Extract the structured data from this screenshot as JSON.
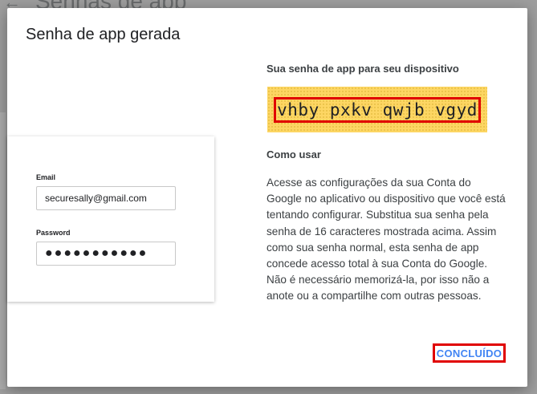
{
  "background": {
    "page_title": "Senhas de app",
    "back_icon": "arrow-left-icon"
  },
  "dialog": {
    "title": "Senha de app gerada",
    "illustration": {
      "email_label": "Email",
      "email_value": "securesally@gmail.com",
      "password_label": "Password",
      "password_value": "●●●●●●●●●●●"
    },
    "password_heading": "Sua senha de app para seu dispositivo",
    "generated_password": "vhby pxkv qwjb vgyd",
    "howto_heading": "Como usar",
    "howto_text": "Acesse as configurações da sua Conta do Google no aplicativo ou dispositivo que você está tentando configurar. Substitua sua senha pela senha de 16 caracteres mostrada acima. Assim como sua senha normal, esta senha de app concede acesso total à sua Conta do Google. Não é necessário memorizá-la, por isso não a anote ou a compartilhe com outras pessoas.",
    "done_label": "CONCLUÍDO"
  },
  "colors": {
    "accent": "#4285f4",
    "highlight_border": "#e00000",
    "password_bg": "#fdd663"
  }
}
